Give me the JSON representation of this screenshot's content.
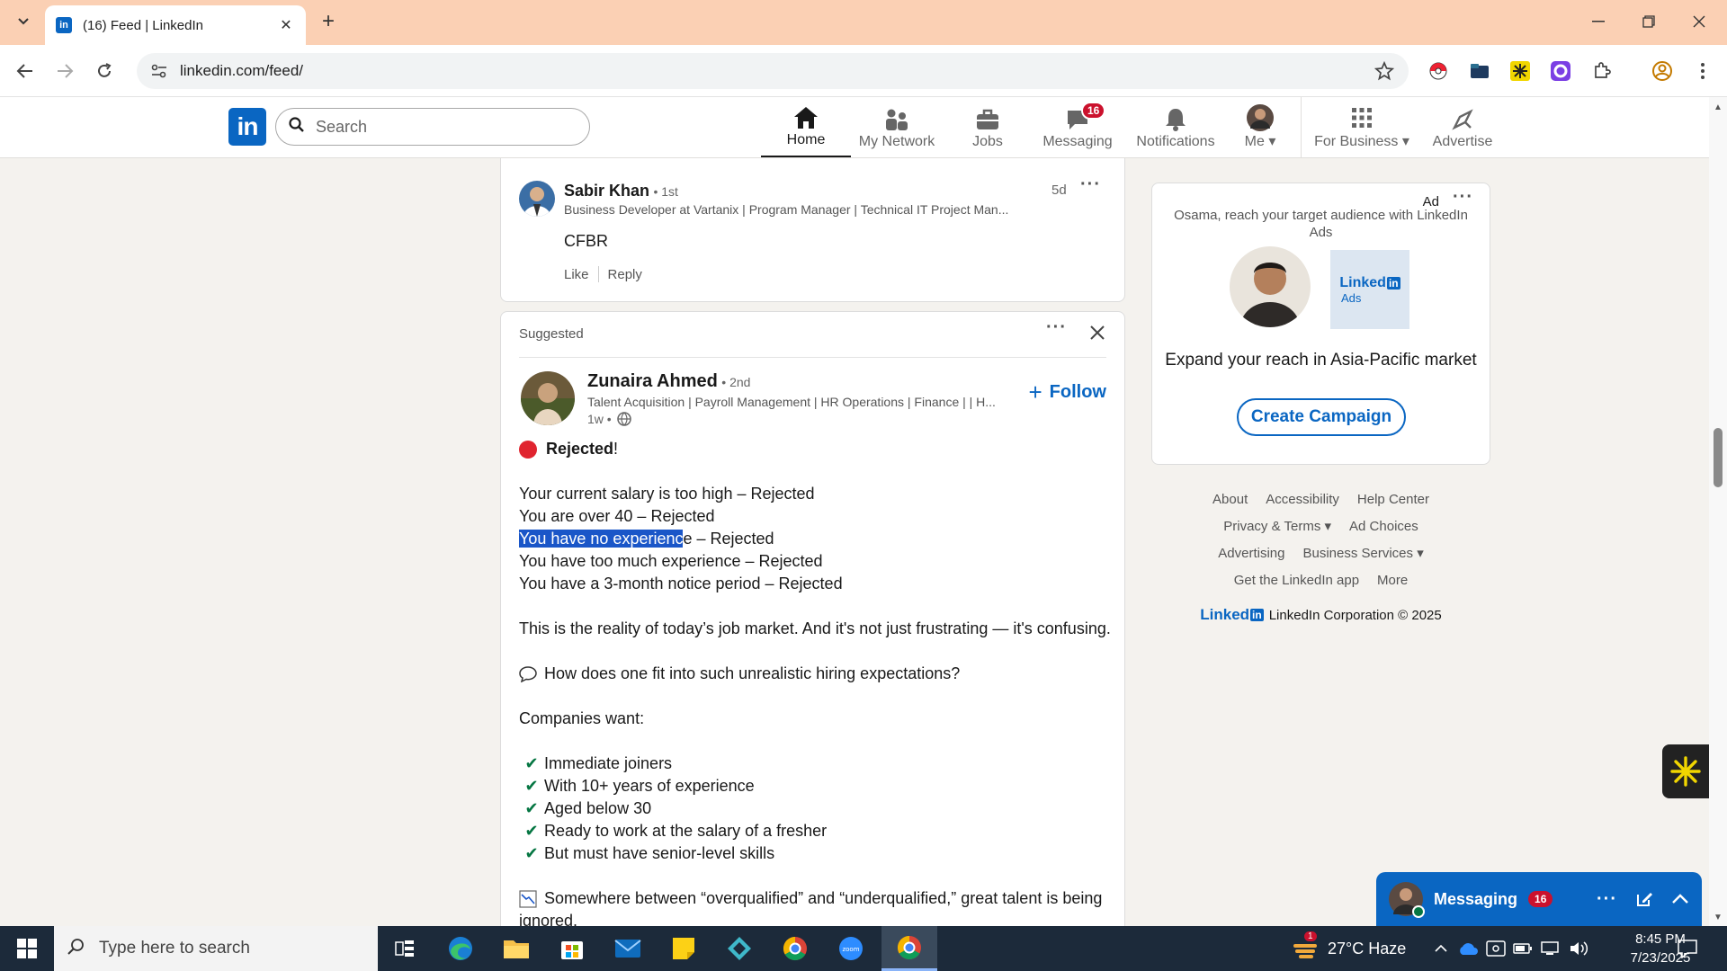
{
  "browser": {
    "tab_title": "(16) Feed | LinkedIn",
    "url": "linkedin.com/feed/"
  },
  "linkedin_header": {
    "logo": "in",
    "search_placeholder": "Search",
    "nav": [
      {
        "label": "Home",
        "icon": "home-icon",
        "active": true
      },
      {
        "label": "My Network",
        "icon": "network-icon"
      },
      {
        "label": "Jobs",
        "icon": "briefcase-icon"
      },
      {
        "label": "Messaging",
        "icon": "chat-icon",
        "badge": "16"
      },
      {
        "label": "Notifications",
        "icon": "bell-icon"
      },
      {
        "label": "Me",
        "icon": "avatar"
      },
      {
        "label": "For Business",
        "icon": "grid-icon"
      },
      {
        "label": "Advertise",
        "icon": "compass-icon"
      }
    ]
  },
  "comment": {
    "name": "Sabir Khan",
    "degree": "• 1st",
    "headline": "Business Developer at Vartanix | Program Manager | Technical IT Project Man...",
    "time": "5d",
    "text": "CFBR",
    "like": "Like",
    "reply": "Reply"
  },
  "post": {
    "suggested": "Suggested",
    "author": "Zunaira Ahmed",
    "degree": "• 2nd",
    "headline": "Talent Acquisition | Payroll Management | HR Operations | Finance | | H...",
    "time": "1w •",
    "follow": "Follow",
    "title": "Rejected",
    "title_suffix": "!",
    "lines": [
      "Your current salary is too high – Rejected",
      "You are over 40 – Rejected"
    ],
    "highlight_selected": "You have no experienc",
    "highlight_rest": "e – Rejected",
    "lines2": [
      "You have too much experience – Rejected",
      "You have a 3-month notice period – Rejected"
    ],
    "reality": "This is the reality of today’s job market. And it's not just frustrating — it's confusing.",
    "question": "How does one fit into such unrealistic hiring expectations?",
    "companies_want": "Companies want:",
    "wants": [
      "Immediate joiners",
      "With 10+ years of experience",
      "Aged below 30",
      "Ready to work at the salary of a fresher",
      "But must have senior-level skills"
    ],
    "closing_1": "Somewhere between “overqualified” and “underqualified,” great talent is being",
    "closing_2": "ignored."
  },
  "ad": {
    "label": "Ad",
    "text": "Osama, reach your target audience with LinkedIn Ads",
    "logo_text": "Linked",
    "logo_in": "in",
    "logo_sub": "Ads",
    "headline": "Expand your reach in Asia-Pacific market",
    "cta": "Create Campaign"
  },
  "footer": {
    "row1": [
      "About",
      "Accessibility",
      "Help Center"
    ],
    "row2": [
      "Privacy & Terms",
      "Ad Choices"
    ],
    "row3": [
      "Advertising",
      "Business Services"
    ],
    "row4": [
      "Get the LinkedIn app",
      "More"
    ],
    "brand": "Linked",
    "brand_in": "in",
    "copyright": "LinkedIn Corporation © 2025"
  },
  "messaging": {
    "title": "Messaging",
    "badge": "16"
  },
  "taskbar": {
    "search_placeholder": "Type here to search",
    "weather": "27°C  Haze",
    "weather_badge": "1",
    "time": "8:45 PM",
    "date": "7/23/2025"
  },
  "colors": {
    "linkedin_blue": "#0a66c2",
    "tab_bar": "#fbd0b4",
    "badge_red": "#cb112d",
    "check_green": "#057642"
  }
}
